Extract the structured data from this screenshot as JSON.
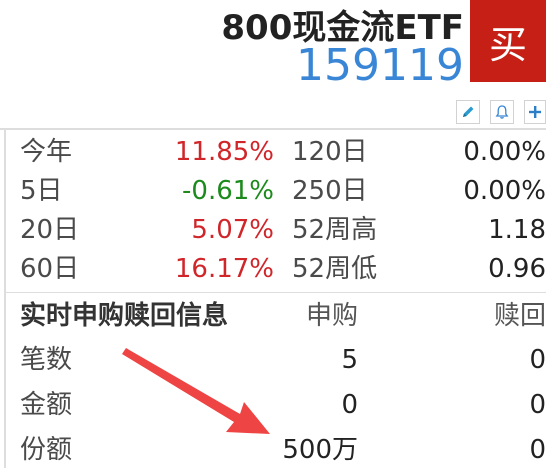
{
  "header": {
    "fund_name": "800现金流ETF",
    "fund_code": "159119",
    "buy_label": "买"
  },
  "toolbar": {
    "icons": [
      "edit-icon",
      "bell-icon",
      "plus-icon"
    ]
  },
  "performance": {
    "rows": [
      {
        "label": "今年",
        "value": "11.85%",
        "label2": "120日",
        "value2": "0.00%"
      },
      {
        "label": "5日",
        "value": "-0.61%",
        "label2": "250日",
        "value2": "0.00%"
      },
      {
        "label": "20日",
        "value": "5.07%",
        "label2": "52周高",
        "value2": "1.18"
      },
      {
        "label": "60日",
        "value": "16.17%",
        "label2": "52周低",
        "value2": "0.96"
      }
    ]
  },
  "subscription": {
    "title": "实时申购赎回信息",
    "col_subscribe": "申购",
    "col_redeem": "赎回",
    "rows": [
      {
        "label": "笔数",
        "subscribe": "5",
        "redeem": "0"
      },
      {
        "label": "金额",
        "subscribe": "0",
        "redeem": "0"
      },
      {
        "label": "份额",
        "subscribe": "500万",
        "redeem": "0"
      }
    ]
  },
  "colors": {
    "accent_blue": "#3a86d6",
    "buy_red": "#c62016",
    "up_red": "#d0262a",
    "down_green": "#1c8a1c",
    "annotation_arrow": "#ee4444"
  }
}
